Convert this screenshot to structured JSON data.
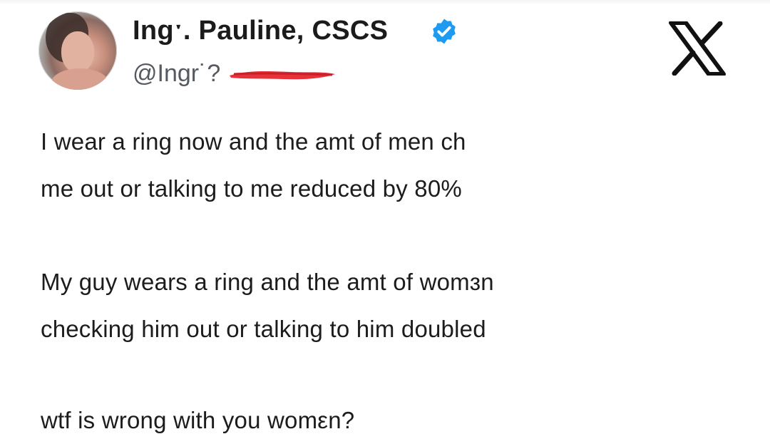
{
  "header": {
    "display_name": "Ingˑ. Pauline, CSCS",
    "handle": "@Ingr˙?",
    "avatar_icon": "profile-photo",
    "verified_icon": "verified-badge-icon",
    "verified_color": "#1d9bf0",
    "redaction_color": "#e8323a",
    "platform_icon": "x-logo-icon"
  },
  "tweet": {
    "lines": [
      "I wear a ring now and the amt of men ch",
      "me out or talking to me reduced by 80%",
      "My guy wears a ring and the amt of womɜn",
      "checking him out or talking to him doubled",
      "wtf is wrong with you womεn?"
    ]
  }
}
